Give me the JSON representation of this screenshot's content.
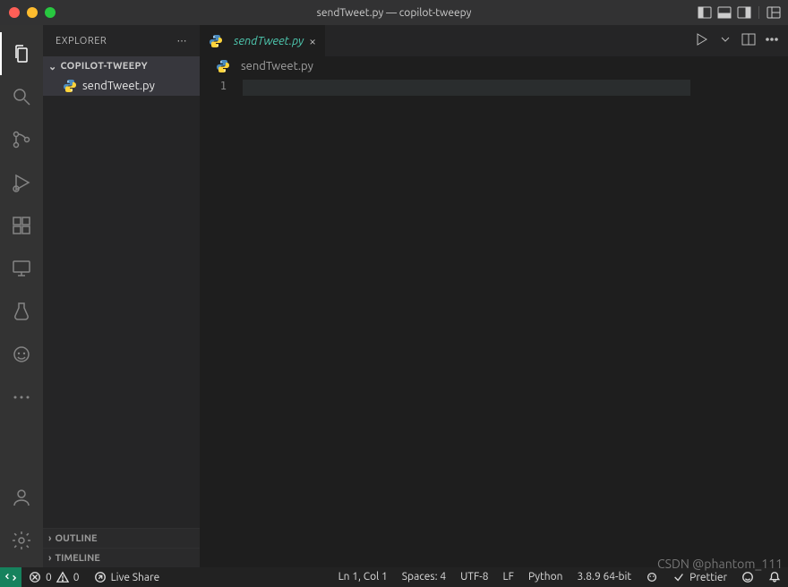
{
  "window": {
    "title": "sendTweet.py — copilot-tweepy"
  },
  "sidebar": {
    "title": "EXPLORER",
    "folder": "COPILOT-TWEEPY",
    "file": "sendTweet.py",
    "sections": [
      "OUTLINE",
      "TIMELINE"
    ]
  },
  "editor": {
    "tab_name": "sendTweet.py",
    "breadcrumb": "sendTweet.py",
    "line_number": "1"
  },
  "status": {
    "errors": "0",
    "warnings": "0",
    "live_share": "Live Share",
    "cursor": "Ln 1, Col 1",
    "spaces": "Spaces: 4",
    "encoding": "UTF-8",
    "eol": "LF",
    "language": "Python",
    "interpreter": "3.8.9 64-bit",
    "prettier": "Prettier"
  },
  "watermark": "CSDN @phantom_111"
}
